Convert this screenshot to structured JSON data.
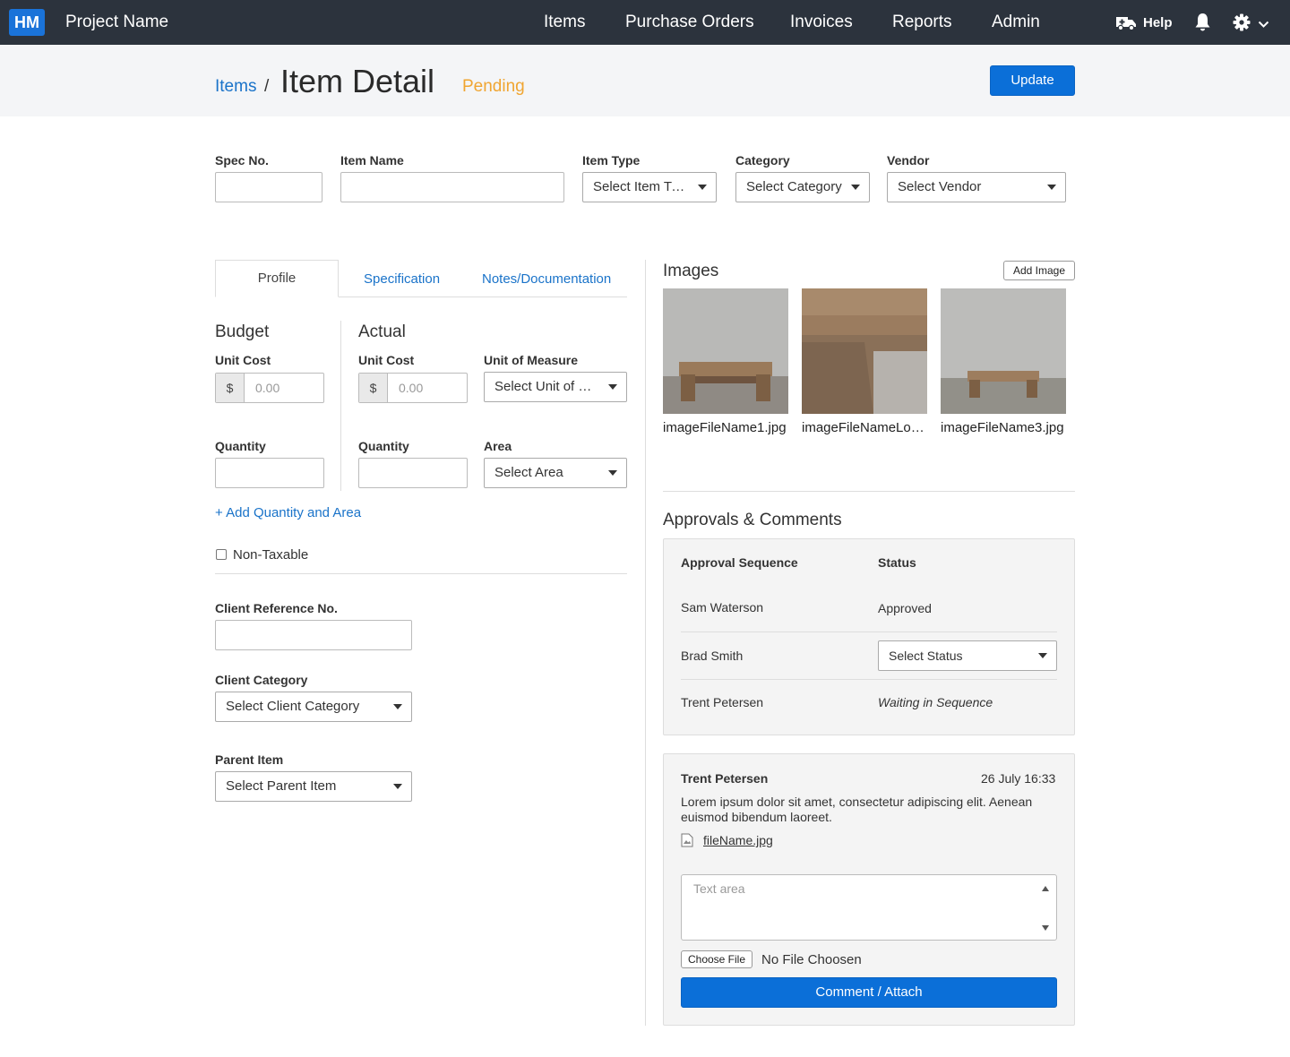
{
  "app": {
    "logo": "HM",
    "project_name": "Project Name"
  },
  "nav": {
    "items": [
      "Items",
      "Purchase Orders",
      "Invoices",
      "Reports",
      "Admin"
    ],
    "help_label": "Help",
    "icons": [
      "ambulance-icon",
      "bell-icon",
      "gear-icon",
      "chevron-down-icon"
    ]
  },
  "header": {
    "breadcrumb": "Items",
    "separator": "/",
    "title": "Item Detail",
    "status": "Pending",
    "update_label": "Update"
  },
  "top_fields": {
    "spec_no": {
      "label": "Spec No.",
      "value": ""
    },
    "item_name": {
      "label": "Item Name",
      "value": ""
    },
    "item_type": {
      "label": "Item Type",
      "value": "Select Item Type"
    },
    "category": {
      "label": "Category",
      "value": "Select Category"
    },
    "vendor": {
      "label": "Vendor",
      "value": "Select Vendor"
    }
  },
  "tabs": [
    "Profile",
    "Specification",
    "Notes/Documentation"
  ],
  "budget": {
    "heading": "Budget",
    "unit_cost_label": "Unit Cost",
    "currency": "$",
    "unit_cost_placeholder": "0.00",
    "quantity_label": "Quantity"
  },
  "actual": {
    "heading": "Actual",
    "unit_cost_label": "Unit Cost",
    "currency": "$",
    "unit_cost_placeholder": "0.00",
    "uom_label": "Unit of Measure",
    "uom_value": "Select Unit of Me...",
    "quantity_label": "Quantity",
    "area_label": "Area",
    "area_value": "Select Area"
  },
  "add_quantity_link": "+ Add Quantity and Area",
  "non_taxable_label": "Non-Taxable",
  "client": {
    "ref_label": "Client Reference No.",
    "category_label": "Client Category",
    "category_value": "Select Client Category",
    "parent_label": "Parent Item",
    "parent_value": "Select Parent Item"
  },
  "images": {
    "heading": "Images",
    "add_label": "Add Image",
    "files": [
      "imageFileName1.jpg",
      "imageFileNameLon...",
      "imageFileName3.jpg"
    ]
  },
  "approvals": {
    "heading": "Approvals & Comments",
    "col_sequence": "Approval Sequence",
    "col_status": "Status",
    "rows": [
      {
        "name": "Sam Waterson",
        "status": "Approved"
      },
      {
        "name": "Brad Smith",
        "status": "Select Status"
      },
      {
        "name": "Trent Petersen",
        "status": "Waiting in Sequence"
      }
    ]
  },
  "comment": {
    "author": "Trent Petersen",
    "timestamp": "26 July 16:33",
    "body": "Lorem ipsum dolor sit amet, consectetur adipiscing elit. Aenean euismod bibendum laoreet.",
    "attachment": "fileName.jpg",
    "textarea_placeholder": "Text area",
    "choose_file_label": "Choose File",
    "no_file_label": "No File Choosen",
    "submit_label": "Comment / Attach"
  },
  "colors": {
    "nav_bg": "#2c333d",
    "accent": "#0b6fd8",
    "link": "#1a73c9",
    "pending": "#f0a531"
  }
}
